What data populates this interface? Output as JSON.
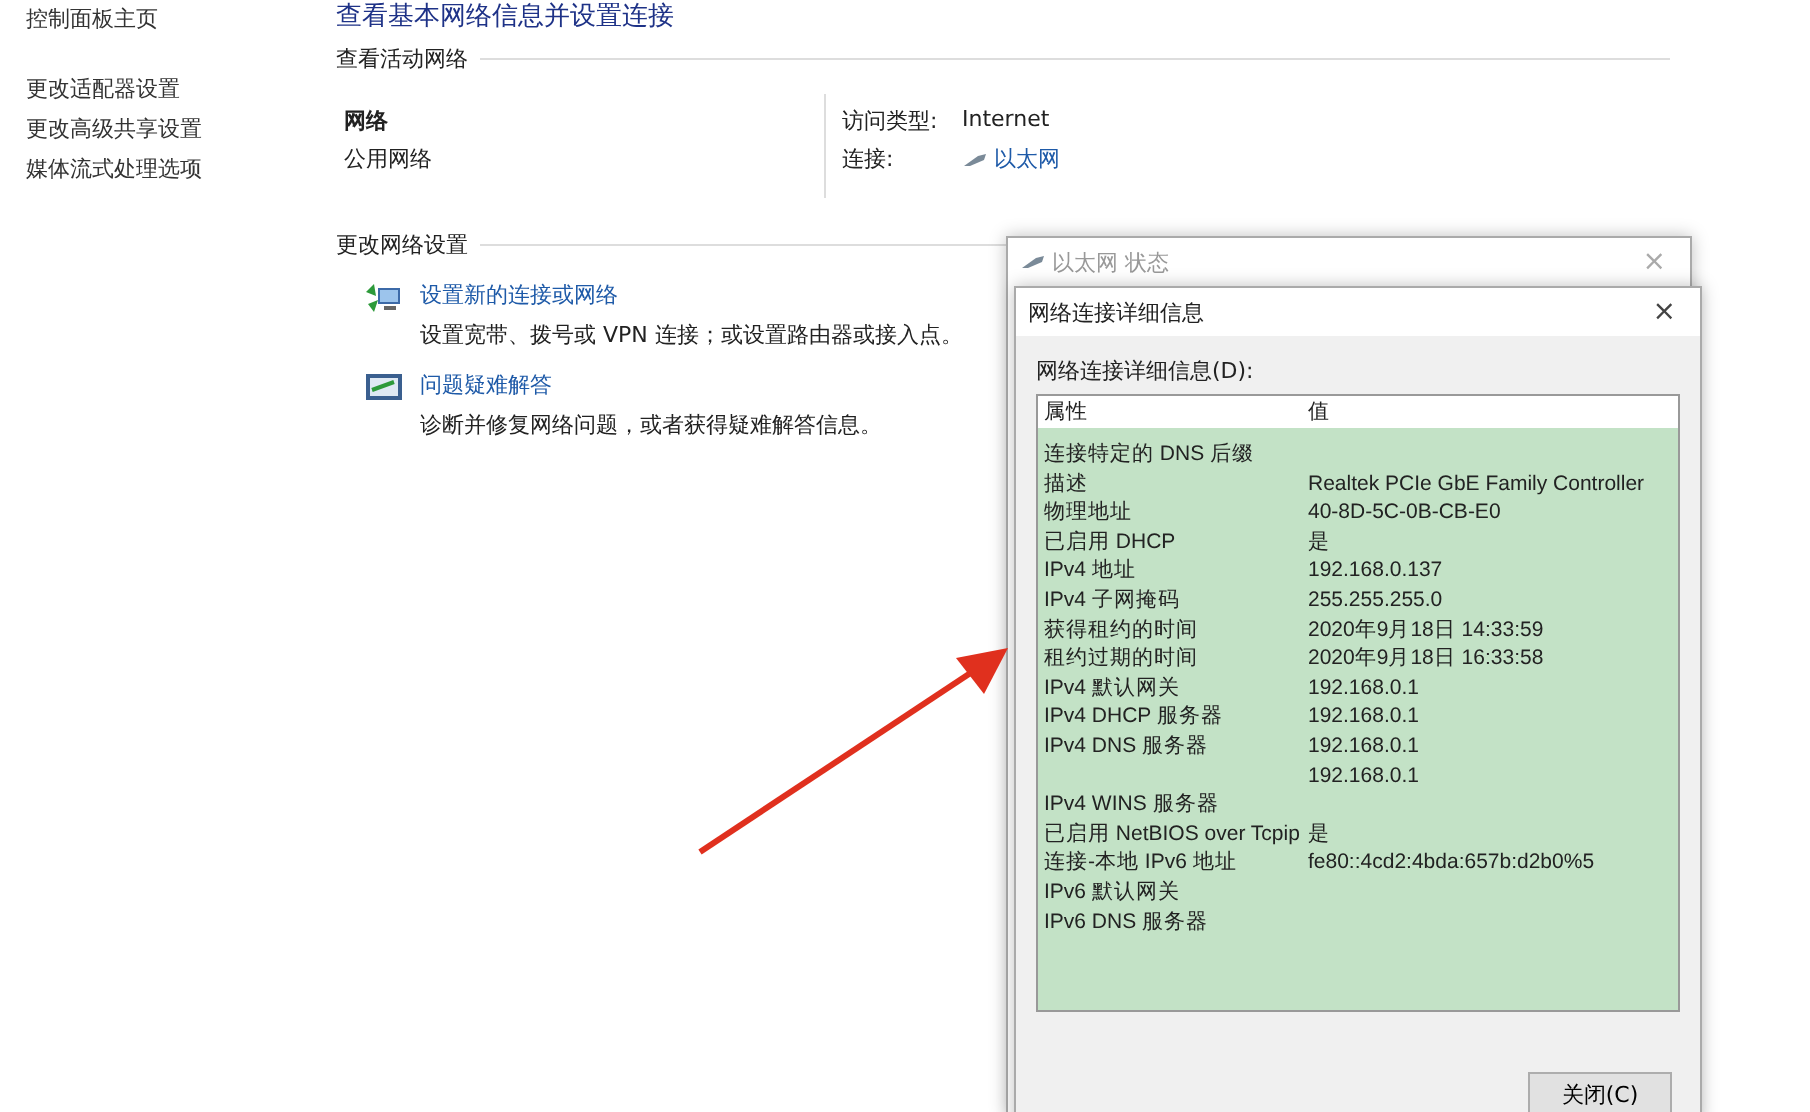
{
  "sidebar": {
    "home": "控制面板主页",
    "links": [
      "更改适配器设置",
      "更改高级共享设置",
      "媒体流式处理选项"
    ]
  },
  "main": {
    "title": "查看基本网络信息并设置连接",
    "active_section": "查看活动网络",
    "network": {
      "name": "网络",
      "type": "公用网络",
      "access_label": "访问类型:",
      "access_value": "Internet",
      "conn_label": "连接:",
      "conn_value": "以太网"
    },
    "change_section": "更改网络设置",
    "tasks": [
      {
        "kind": "setup",
        "link": "设置新的连接或网络",
        "desc": "设置宽带、拨号或 VPN 连接；或设置路由器或接入点。"
      },
      {
        "kind": "troubleshoot",
        "link": "问题疑难解答",
        "desc": "诊断并修复网络问题，或者获得疑难解答信息。"
      }
    ]
  },
  "status_window": {
    "title": "以太网 状态",
    "close": "×"
  },
  "details_dialog": {
    "title": "网络连接详细信息",
    "close": "×",
    "list_label": "网络连接详细信息(D):",
    "columns": [
      "属性",
      "值"
    ],
    "rows": [
      [
        "连接特定的 DNS 后缀",
        ""
      ],
      [
        "描述",
        "Realtek PCIe GbE Family Controller"
      ],
      [
        "物理地址",
        "40-8D-5C-0B-CB-E0"
      ],
      [
        "已启用 DHCP",
        "是"
      ],
      [
        "IPv4 地址",
        "192.168.0.137"
      ],
      [
        "IPv4 子网掩码",
        "255.255.255.0"
      ],
      [
        "获得租约的时间",
        "2020年9月18日 14:33:59"
      ],
      [
        "租约过期的时间",
        "2020年9月18日 16:33:58"
      ],
      [
        "IPv4 默认网关",
        "192.168.0.1"
      ],
      [
        "IPv4 DHCP 服务器",
        "192.168.0.1"
      ],
      [
        "IPv4 DNS 服务器",
        "192.168.0.1"
      ],
      [
        "",
        "192.168.0.1"
      ],
      [
        "IPv4 WINS 服务器",
        ""
      ],
      [
        "已启用 NetBIOS over Tcpip",
        "是"
      ],
      [
        "连接-本地 IPv6 地址",
        "fe80::4cd2:4bda:657b:d2b0%5"
      ],
      [
        "IPv6 默认网关",
        ""
      ],
      [
        "IPv6 DNS 服务器",
        ""
      ]
    ],
    "button": "关闭(C)"
  }
}
